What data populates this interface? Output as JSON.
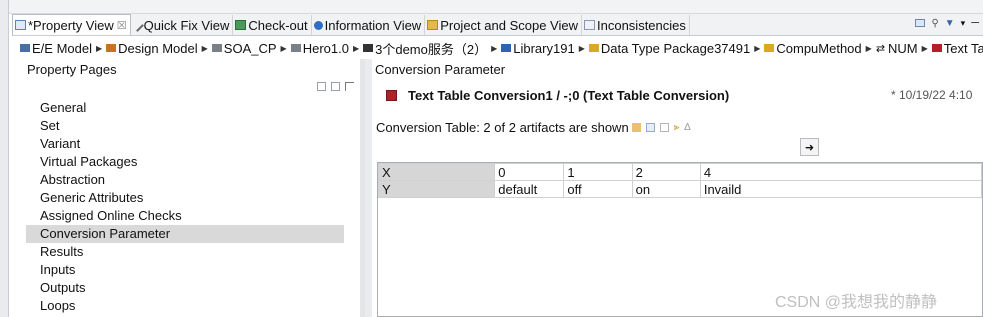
{
  "tabs": [
    {
      "label": "*Property View",
      "active": true,
      "closable": true,
      "icon": "window-icon"
    },
    {
      "label": "Quick Fix View",
      "icon": "wand-icon"
    },
    {
      "label": "Check-out",
      "icon": "checkout-icon"
    },
    {
      "label": "Information View",
      "icon": "info-icon"
    },
    {
      "label": "Project and Scope View",
      "icon": "folder-icon"
    },
    {
      "label": "Inconsistencies",
      "icon": "list-icon"
    }
  ],
  "breadcrumb": [
    "E/E Model",
    "Design Model",
    "SOA_CP",
    "Hero1.0",
    "3个demo服务（2）",
    "Library191",
    "Data Type Package37491",
    "CompuMethod",
    "NUM",
    "Text Table C"
  ],
  "left_panel": {
    "title": "Property Pages",
    "items": [
      "General",
      "Set",
      "Variant",
      "Virtual Packages",
      "Abstraction",
      "Generic Attributes",
      "Assigned Online Checks",
      "Conversion Parameter",
      "Results",
      "Inputs",
      "Outputs",
      "Loops"
    ],
    "selected_index": 7
  },
  "right_panel": {
    "title": "Conversion Parameter",
    "heading": "Text Table Conversion1 / -;0 (Text Table Conversion)",
    "date": "* 10/19/22 4:10",
    "count_text": "Conversion Table: 2 of 2 artifacts are shown",
    "arrow_label": "➜",
    "table": {
      "x_label": "X",
      "y_label": "Y",
      "x_values": [
        "0",
        "1",
        "2",
        "4"
      ],
      "y_values": [
        "default",
        "off",
        "on",
        "Invaild"
      ]
    }
  },
  "watermark": "CSDN @我想我的静静"
}
